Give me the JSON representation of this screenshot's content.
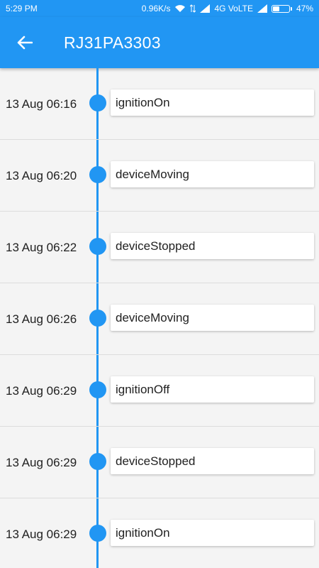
{
  "status_bar": {
    "time": "5:29 PM",
    "speed": "0.96K/s",
    "network": "4G VoLTE",
    "battery": "47%",
    "battery_level": 0.47
  },
  "app_bar": {
    "back_icon": "arrow-left-icon",
    "title": "RJ31PA3303"
  },
  "colors": {
    "primary": "#2196f3"
  },
  "events": [
    {
      "time": "13 Aug 06:16",
      "event": "ignitionOn"
    },
    {
      "time": "13 Aug 06:20",
      "event": "deviceMoving"
    },
    {
      "time": "13 Aug 06:22",
      "event": "deviceStopped"
    },
    {
      "time": "13 Aug 06:26",
      "event": "deviceMoving"
    },
    {
      "time": "13 Aug 06:29",
      "event": "ignitionOff"
    },
    {
      "time": "13 Aug 06:29",
      "event": "deviceStopped"
    },
    {
      "time": "13 Aug 06:29",
      "event": "ignitionOn"
    }
  ]
}
